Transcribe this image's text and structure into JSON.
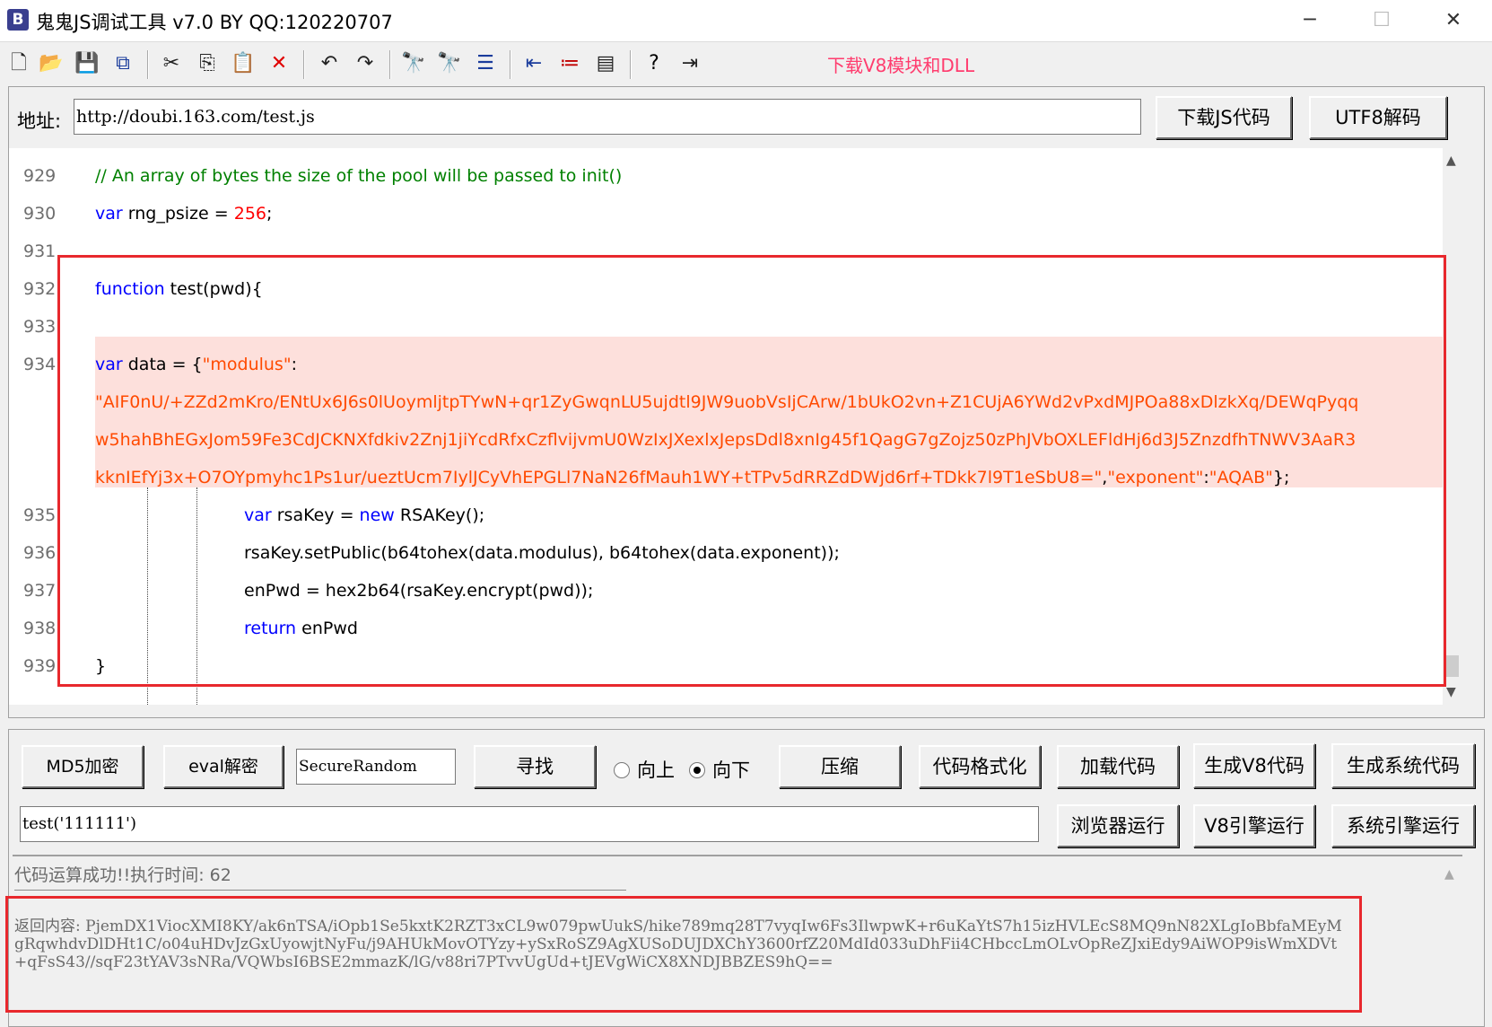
{
  "window": {
    "title": "鬼鬼JS调试工具 v7.0 BY QQ:120220707",
    "app_icon": "B",
    "minimize": "─",
    "maximize": "☐",
    "close": "✕"
  },
  "toolbar": {
    "icons": [
      "new-file-icon",
      "open-folder-icon",
      "save-icon",
      "save-all-icon",
      "cut-icon",
      "copy-icon",
      "paste-icon",
      "delete-icon",
      "undo-icon",
      "redo-icon",
      "find-icon",
      "find-next-icon",
      "indent-icon",
      "outdent-icon",
      "list-icon",
      "window-icon",
      "help-cursor-icon",
      "exit-icon"
    ],
    "download_v8_link": "下载V8模块和DLL"
  },
  "address": {
    "label": "地址:",
    "value": "http://doubi.163.com/test.js",
    "download_button": "下载JS代码",
    "utf8_button": "UTF8解码"
  },
  "editor": {
    "lines": [
      {
        "no": "929",
        "comment": "// An array of bytes the size of the pool will be passed to init()"
      },
      {
        "no": "930",
        "kw": "var",
        "text": " rng_psize = ",
        "num": "256",
        "tail": ";"
      },
      {
        "no": "931"
      },
      {
        "no": "932",
        "kw": "function",
        "text": " test(pwd){"
      },
      {
        "no": "933"
      },
      {
        "no": "934",
        "kw": "var",
        "text": " data = {",
        "str": "\"modulus\"",
        "tail": ":"
      },
      {
        "no": "",
        "str": "\"AIF0nU/+ZZd2mKro/ENtUx6J6s0lUoymljtpTYwN+qr1ZyGwqnLU5ujdtl9JW9uobVsIjCArw/1bUkO2vn+Z1CUjA6YWd2vPxdMJPOa88xDlzkXq/DEWqPyqq"
      },
      {
        "no": "",
        "str": "w5hahBhEGxJom59Fe3CdJCKNXfdkiv2Znj1jiYcdRfxCzflvijvmU0WzIxJXexlxJepsDdl8xnIg45f1QagG7gZojz50zPhJVbOXLEFldHj6d3J5ZnzdfhTNWV3AaR3"
      },
      {
        "no": "",
        "str": "kknIEfYj3x+O7OYpmyhc1Ps1ur/ueztUcm7IylJCyVhEPGLl7NaN26fMauh1WY+tTPv5dRRZdDWjd6rf+TDkk7l9T1eSbU8=\"",
        "tail": ",",
        "str2": "\"exponent\"",
        "tail2": ":",
        "str3": "\"AQAB\"",
        "tail3": "};"
      },
      {
        "no": "935",
        "text": "var rsaKey = new RSAKey();",
        "kw": "var",
        "kw2": "new",
        "a": " rsaKey = ",
        "b": " RSAKey();"
      },
      {
        "no": "936",
        "text": "rsaKey.setPublic(b64tohex(data.modulus), b64tohex(data.exponent));"
      },
      {
        "no": "937",
        "text": "enPwd = hex2b64(rsaKey.encrypt(pwd));"
      },
      {
        "no": "938",
        "kw": "return",
        "text": " enPwd"
      },
      {
        "no": "939",
        "text": "}"
      }
    ]
  },
  "controls": {
    "md5_button": "MD5加密",
    "eval_button": "eval解密",
    "search_value": "SecureRandom",
    "find_button": "寻找",
    "radio_up": "向上",
    "radio_down": "向下",
    "radio_selected": "向下",
    "compress_button": "压缩",
    "format_button": "代码格式化",
    "load_button": "加载代码",
    "gen_v8_button": "生成V8代码",
    "gen_sys_button": "生成系统代码",
    "command_value": "test('111111')",
    "browser_run_button": "浏览器运行",
    "v8_run_button": "V8引擎运行",
    "sys_run_button": "系统引擎运行"
  },
  "output": {
    "status": "代码运算成功!!执行时间: 62",
    "result": "返回内容: PjemDX1ViocXMI8KY/ak6nTSA/iOpb1Se5kxtK2RZT3xCL9w079pwUukS/hike789mq28T7vyqIw6Fs3IlwpwK+r6uKaYtS7h15izHVLEcS8MQ9nN82XLgIoBbfaMEyMgRqwhdvDlDHt1C/o04uHDvJzGxUyowjtNyFu/j9AHUkMovOTYzy+ySxRoSZ9AgXUSoDUJDXChY3600rfZ20MdId033uDhFii4CHbccLmOLvOpReZJxiEdy9AiWOP9isWmXDVt+qFsS43//sqF23tYAV3sNRa/VQWbsI6BSE2mmazK/lG/v88ri7PTvvUgUd+tJEVgWiCX8XNDJBBZES9hQ=="
  }
}
